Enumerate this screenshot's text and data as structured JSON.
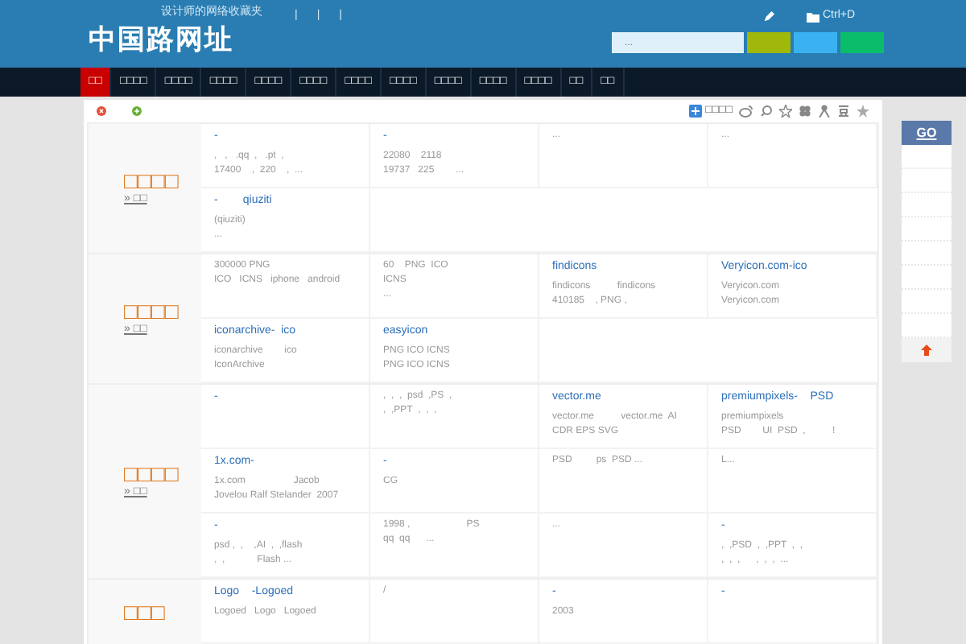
{
  "header": {
    "logo": "中国路网址",
    "tagline": "设计师的网络收藏夹",
    "separators": [
      "|",
      "|",
      "|"
    ],
    "bookmark_hint": "Ctrl+D",
    "search": {
      "placeholder": "..."
    }
  },
  "nav": [
    {
      "label": "□□",
      "selected": true
    },
    {
      "label": "□□□□",
      "selected": false
    },
    {
      "label": "□□□□",
      "selected": false
    },
    {
      "label": "□□□□",
      "selected": false
    },
    {
      "label": "□□□□",
      "selected": false
    },
    {
      "label": "□□□□",
      "selected": false
    },
    {
      "label": "□□□□",
      "selected": false
    },
    {
      "label": "□□□□",
      "selected": false
    },
    {
      "label": "□□□□",
      "selected": false
    },
    {
      "label": "□□□□",
      "selected": false
    },
    {
      "label": "□□□□",
      "selected": false
    },
    {
      "label": "□□",
      "selected": false
    },
    {
      "label": "□□",
      "selected": false
    }
  ],
  "share": {
    "label": "□□□□"
  },
  "categories": [
    {
      "title": "□□□□",
      "more": "» □□",
      "rows": [
        [
          {
            "title": "-",
            "lines": [
              ",   ,   .qq  ,   .pt  ,",
              "17400    ,  220    ,  ..."
            ]
          },
          {
            "title": "-",
            "lines": [
              "22080    2118",
              "19737   225        ..."
            ]
          },
          {
            "lines": [
              "..."
            ]
          },
          {
            "lines": [
              "..."
            ]
          }
        ],
        [
          {
            "title": "-        qiuziti",
            "lines": [
              "(qiuziti)",
              "..."
            ]
          }
        ]
      ]
    },
    {
      "title": "□□□□",
      "more": "» □□",
      "rows": [
        [
          {
            "lines": [
              "300000 PNG",
              "ICO   ICNS   iphone   android"
            ]
          },
          {
            "lines": [
              "60    PNG  ICO",
              "ICNS",
              "..."
            ]
          },
          {
            "title": "findicons",
            "lines": [
              "findicons          findicons",
              "410185    , PNG ,"
            ]
          },
          {
            "title": "Veryicon.com-ico",
            "lines": [
              "Veryicon.com",
              "Veryicon.com"
            ]
          }
        ],
        [
          {
            "title": "iconarchive-  ico",
            "lines": [
              "iconarchive        ico",
              "IconArchive"
            ]
          },
          {
            "title": "easyicon",
            "lines": [
              "PNG ICO ICNS",
              "PNG ICO ICNS"
            ]
          }
        ]
      ]
    },
    {
      "title": "□□□□",
      "more": "» □□",
      "rows": [
        [
          {
            "title": "-"
          },
          {
            "lines": [
              ",  ,  ,  psd  ,PS  ,",
              ",  ,PPT  ,  ,  ,"
            ]
          },
          {
            "title": "vector.me",
            "lines": [
              "vector.me          vector.me  AI",
              "CDR EPS SVG"
            ]
          },
          {
            "title": "premiumpixels-    PSD",
            "lines": [
              "premiumpixels",
              "PSD        UI  PSD  ,          !"
            ]
          }
        ],
        [
          {
            "title": "1x.com-",
            "lines": [
              "1x.com                  Jacob",
              "Jovelou Ralf Stelander  2007"
            ]
          },
          {
            "title": "-",
            "lines": [
              "CG"
            ]
          },
          {
            "lines": [
              "PSD         ps  PSD ..."
            ]
          },
          {
            "lines": [
              "L..."
            ]
          }
        ],
        [
          {
            "title": "-",
            "lines": [
              "psd ,  ,    ,AI  ,  ,flash",
              ",  ,            Flash ..."
            ]
          },
          {
            "lines": [
              "1998 ,                     PS",
              "qq  qq      ..."
            ]
          },
          {
            "lines": [
              "..."
            ]
          },
          {
            "title": "-",
            "lines": [
              ",  ,PSD  ,  ,PPT  ,  ,",
              ",  ,  ,      ,  ,  ,  ..."
            ]
          }
        ]
      ]
    },
    {
      "title": "□□□",
      "rows": [
        [
          {
            "title": "Logo    -Logoed",
            "lines": [
              "Logoed   Logo   Logoed"
            ]
          },
          {
            "lines": [
              "/"
            ]
          },
          {
            "title": "-",
            "lines": [
              "2003"
            ]
          },
          {
            "title": "-"
          }
        ]
      ]
    }
  ],
  "sidebar": {
    "go": "GO"
  }
}
